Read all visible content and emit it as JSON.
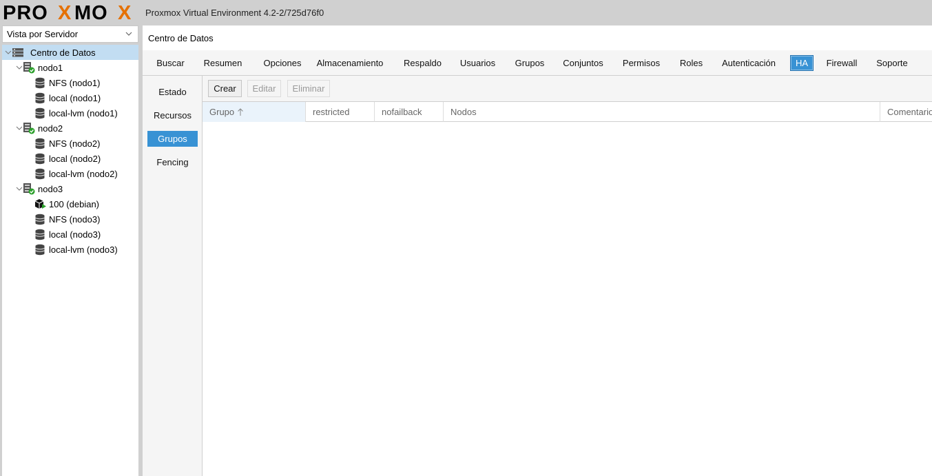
{
  "header": {
    "logo_text": "PROXMOX",
    "app_version": "Proxmox Virtual Environment 4.2-2/725d76f0"
  },
  "sidebar": {
    "view_select": {
      "value": "Vista por Servidor"
    },
    "tree": [
      {
        "label": "Centro de Datos",
        "type": "datacenter",
        "level": 0,
        "expanded": true,
        "selected": true
      },
      {
        "label": "nodo1",
        "type": "node",
        "level": 1,
        "expanded": true,
        "status": "online"
      },
      {
        "label": "NFS (nodo1)",
        "type": "storage",
        "level": 2
      },
      {
        "label": "local (nodo1)",
        "type": "storage",
        "level": 2
      },
      {
        "label": "local-lvm (nodo1)",
        "type": "storage",
        "level": 2
      },
      {
        "label": "nodo2",
        "type": "node",
        "level": 1,
        "expanded": true,
        "status": "online"
      },
      {
        "label": "NFS (nodo2)",
        "type": "storage",
        "level": 2
      },
      {
        "label": "local (nodo2)",
        "type": "storage",
        "level": 2
      },
      {
        "label": "local-lvm (nodo2)",
        "type": "storage",
        "level": 2
      },
      {
        "label": "nodo3",
        "type": "node",
        "level": 1,
        "expanded": true,
        "status": "online"
      },
      {
        "label": "100 (debian)",
        "type": "vm-running",
        "level": 2
      },
      {
        "label": "NFS (nodo3)",
        "type": "storage",
        "level": 2
      },
      {
        "label": "local (nodo3)",
        "type": "storage",
        "level": 2
      },
      {
        "label": "local-lvm (nodo3)",
        "type": "storage",
        "level": 2
      }
    ]
  },
  "main": {
    "breadcrumb": "Centro de Datos",
    "tabs": [
      {
        "label": "Buscar",
        "active": false
      },
      {
        "label": "Resumen",
        "active": false
      },
      {
        "label": "Opciones",
        "active": false
      },
      {
        "label": "Almacenamiento",
        "active": false
      },
      {
        "label": "Respaldo",
        "active": false
      },
      {
        "label": "Usuarios",
        "active": false
      },
      {
        "label": "Grupos",
        "active": false
      },
      {
        "label": "Conjuntos",
        "active": false
      },
      {
        "label": "Permisos",
        "active": false
      },
      {
        "label": "Roles",
        "active": false
      },
      {
        "label": "Autenticación",
        "active": false
      },
      {
        "label": "HA",
        "active": true
      },
      {
        "label": "Firewall",
        "active": false
      },
      {
        "label": "Soporte",
        "active": false
      }
    ],
    "subnav": [
      {
        "label": "Estado",
        "active": false
      },
      {
        "label": "Recursos",
        "active": false
      },
      {
        "label": "Grupos",
        "active": true
      },
      {
        "label": "Fencing",
        "active": false
      }
    ],
    "toolbar": {
      "buttons": [
        {
          "label": "Crear",
          "enabled": true
        },
        {
          "label": "Editar",
          "enabled": false
        },
        {
          "label": "Eliminar",
          "enabled": false
        }
      ]
    },
    "grid": {
      "columns": [
        {
          "label": "Grupo",
          "sorted": "asc"
        },
        {
          "label": "restricted"
        },
        {
          "label": "nofailback"
        },
        {
          "label": "Nodos"
        },
        {
          "label": "Comentario"
        }
      ],
      "rows": []
    }
  },
  "colors": {
    "accent": "#3892d4",
    "selected_tree": "#c2ddf2",
    "logo_orange": "#e57000",
    "status_green": "#2ca02c"
  }
}
